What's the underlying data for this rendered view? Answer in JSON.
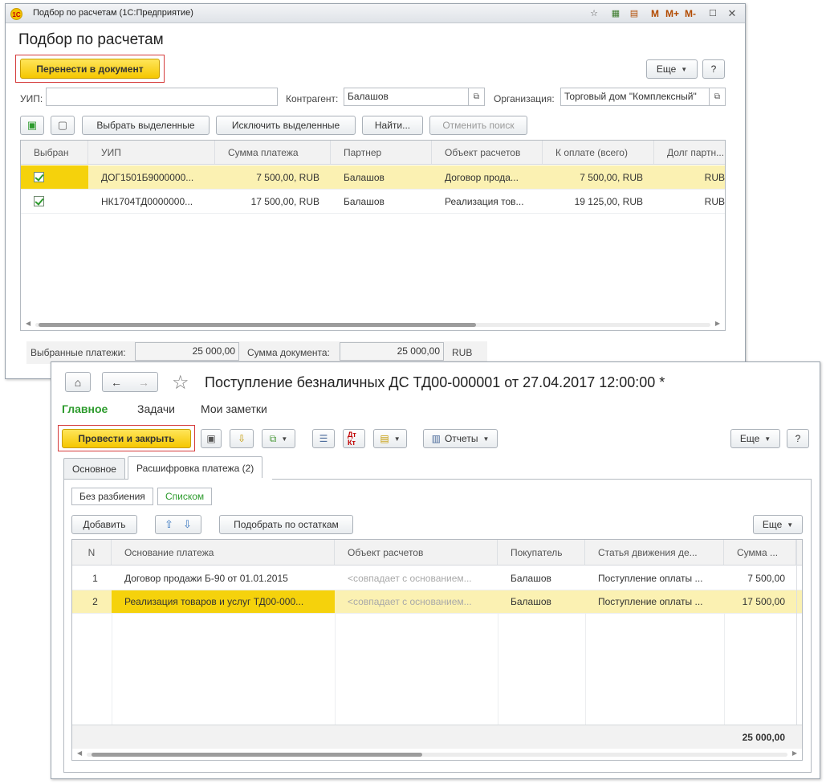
{
  "win1": {
    "title": "Подбор по расчетам  (1С:Предприятие)",
    "toolbar_m": "M",
    "toolbar_mplus": "M+",
    "toolbar_mminus": "M-",
    "form_title": "Подбор по расчетам",
    "transfer_button": "Перенести в документ",
    "more_button": "Еще",
    "help_button": "?",
    "uip_label": "УИП:",
    "uip_value": "",
    "counterparty_label": "Контрагент:",
    "counterparty_value": "Балашов",
    "org_label": "Организация:",
    "org_value": "Торговый дом \"Комплексный\"",
    "select_selected": "Выбрать выделенные",
    "exclude_selected": "Исключить выделенные",
    "find_button": "Найти...",
    "cancel_search": "Отменить поиск",
    "table": {
      "headers": [
        "Выбран",
        "УИП",
        "Сумма платежа",
        "Партнер",
        "Объект расчетов",
        "К оплате (всего)",
        "Долг партн..."
      ],
      "rows": [
        {
          "selected": true,
          "uip": "ДОГ1501Б9000000...",
          "amount": "7 500,00, RUB",
          "partner": "Балашов",
          "object": "Договор прода...",
          "to_pay": "7 500,00, RUB",
          "debt": "RUB"
        },
        {
          "selected": true,
          "uip": "НК1704ТД0000000...",
          "amount": "17 500,00, RUB",
          "partner": "Балашов",
          "object": "Реализация тов...",
          "to_pay": "19 125,00, RUB",
          "debt": "RUB"
        }
      ]
    },
    "footer": {
      "selected_payments_label": "Выбранные платежи:",
      "selected_payments_value": "25 000,00",
      "doc_sum_label": "Сумма документа:",
      "doc_sum_value": "25 000,00",
      "currency": "RUB"
    }
  },
  "win2": {
    "title": "Поступление безналичных ДС ТД00-000001 от 27.04.2017 12:00:00 *",
    "nav_tabs": [
      "Главное",
      "Задачи",
      "Мои заметки"
    ],
    "post_close_button": "Провести и закрыть",
    "reports_button": "Отчеты",
    "more_button": "Еще",
    "help_button": "?",
    "tabs": [
      "Основное",
      "Расшифровка платежа (2)"
    ],
    "mode_segments": [
      "Без разбиения",
      "Списком"
    ],
    "add_button": "Добавить",
    "pick_by_balance": "Подобрать по остаткам",
    "table_more": "Еще",
    "table": {
      "headers": [
        "N",
        "Основание платежа",
        "Объект расчетов",
        "Покупатель",
        "Статья движения де...",
        "Сумма ..."
      ],
      "rows": [
        {
          "n": "1",
          "basis": "Договор продажи Б-90 от 01.01.2015",
          "object": "<совпадает с основанием...",
          "buyer": "Балашов",
          "item": "Поступление оплаты ...",
          "sum": "7 500,00"
        },
        {
          "n": "2",
          "basis": "Реализация товаров и услуг ТД00-000...",
          "object": "<совпадает с основанием...",
          "buyer": "Балашов",
          "item": "Поступление оплаты ...",
          "sum": "17 500,00"
        }
      ],
      "total": "25 000,00"
    }
  },
  "colors": {
    "accent_yellow": "#f5c700",
    "selected_row": "#fbf1b2",
    "highlight_cell": "#f5d20c",
    "green_active": "#2d9b2d",
    "red_frame": "#d53b3b"
  }
}
